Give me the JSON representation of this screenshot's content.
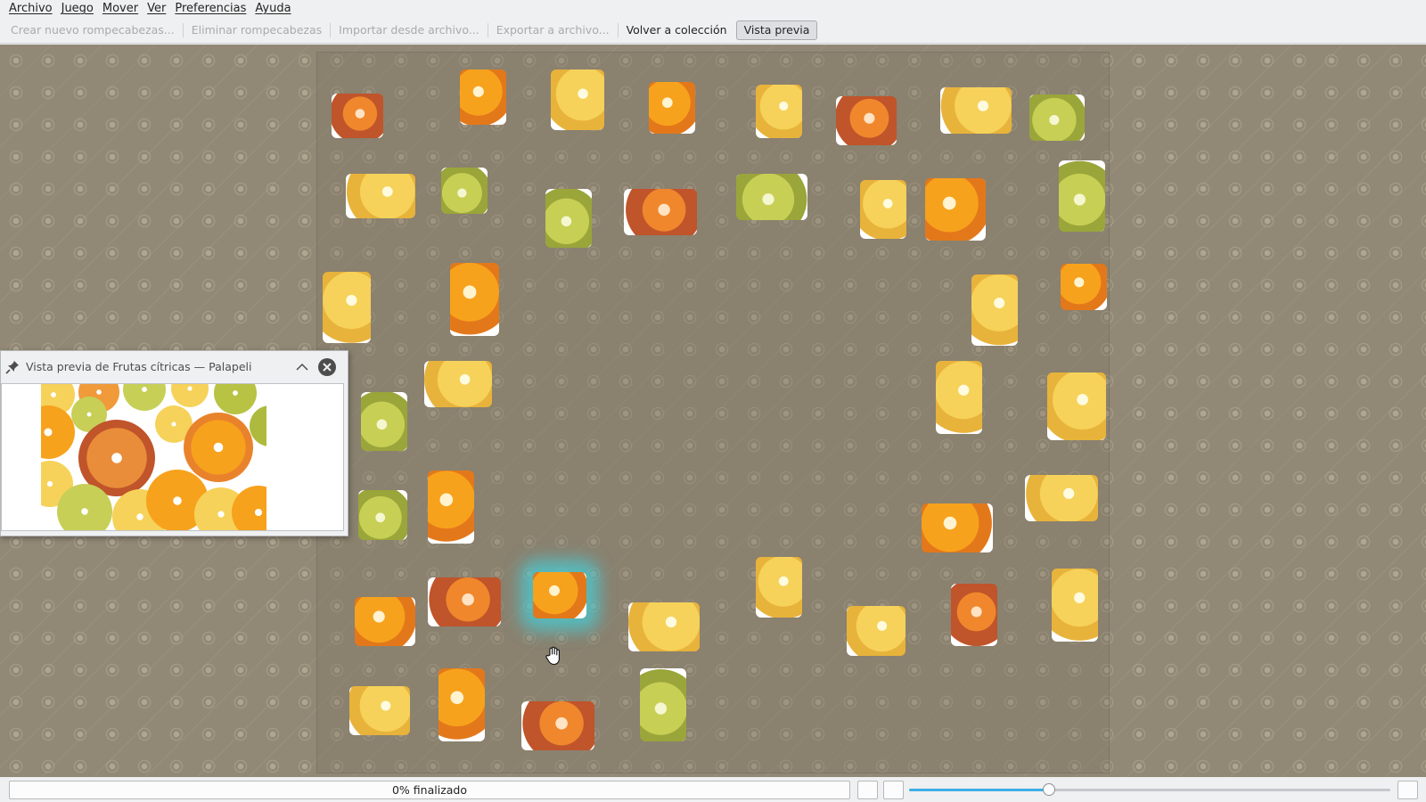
{
  "menubar": {
    "items": [
      "Archivo",
      "Juego",
      "Mover",
      "Ver",
      "Preferencias",
      "Ayuda"
    ]
  },
  "toolbar": {
    "create_label": "Crear nuevo rompecabezas...",
    "delete_label": "Eliminar rompecabezas",
    "import_label": "Importar desde archivo...",
    "export_label": "Exportar a archivo...",
    "back_label": "Volver a colección",
    "preview_label": "Vista previa"
  },
  "preview_window": {
    "title": "Vista previa de Frutas cítricas — Palapeli",
    "pin_icon": "pin-icon",
    "collapse_icon": "chevron-up-icon",
    "close_icon": "close-icon"
  },
  "status": {
    "progress_text": "0% finalizado",
    "zoom_level": 0.29
  },
  "colors": {
    "accent": "#3daee9",
    "canvas_bg": "#918876",
    "selection_glow": "#46cdd7"
  }
}
